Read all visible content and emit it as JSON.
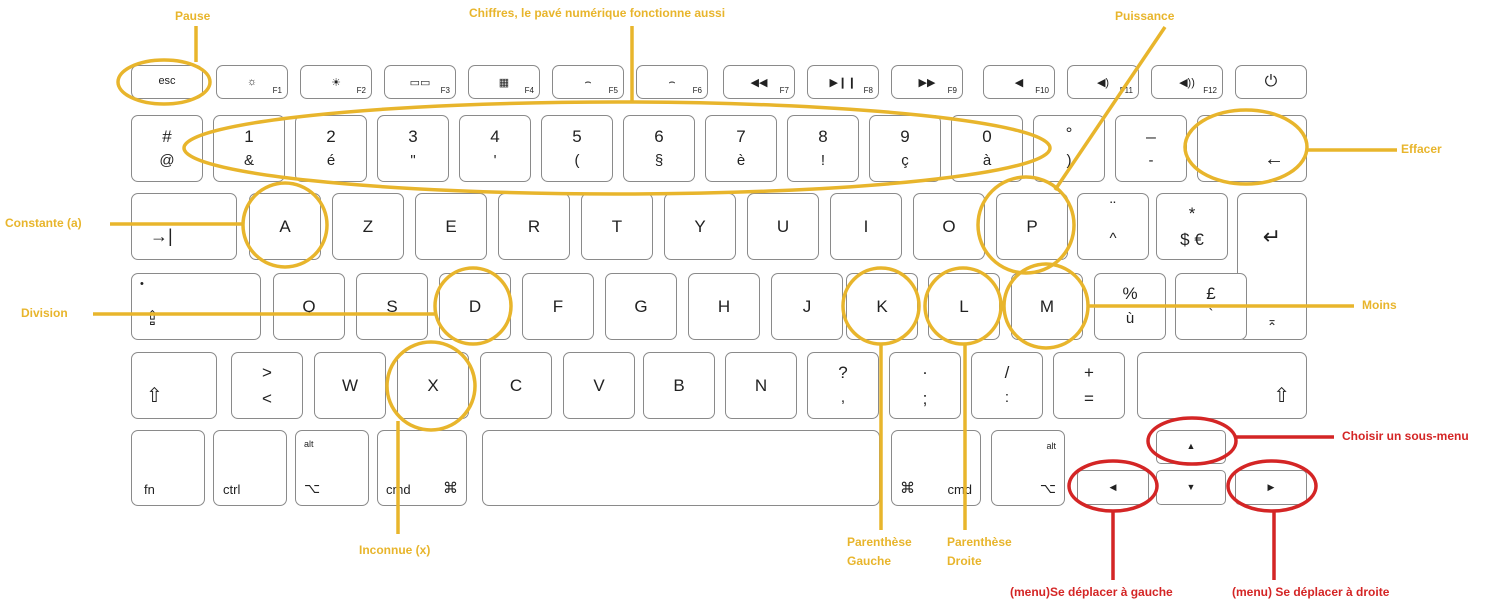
{
  "colors": {
    "annotation_yellow": "#e8b52c",
    "annotation_red": "#d42525",
    "key_border": "#8a8a8a"
  },
  "annotations": {
    "pause": "Pause",
    "chiffres": "Chiffres, le pavé numérique fonctionne aussi",
    "puissance": "Puissance",
    "effacer": "Effacer",
    "constante": "Constante (a)",
    "division": "Division",
    "moins": "Moins",
    "choisir": "Choisir un sous-menu",
    "inconnue": "Inconnue (x)",
    "par_gauche_1": "Parenthèse",
    "par_gauche_2": "Gauche",
    "par_droite_1": "Parenthèse",
    "par_droite_2": "Droite",
    "menu_gauche": "(menu)Se déplacer à gauche",
    "menu_droite": "(menu) Se déplacer à droite"
  },
  "keys": {
    "esc": "esc",
    "f1": {
      "icon": "☼",
      "label": "F1"
    },
    "f2": {
      "icon": "☀",
      "label": "F2"
    },
    "f3": {
      "icon": "▭▭",
      "label": "F3"
    },
    "f4": {
      "icon": "▦",
      "label": "F4"
    },
    "f5": {
      "icon": "⌢",
      "label": "F5"
    },
    "f6": {
      "icon": "⌢",
      "label": "F6"
    },
    "f7": {
      "icon": "◀◀",
      "label": "F7"
    },
    "f8": {
      "icon": "▶❙❙",
      "label": "F8"
    },
    "f9": {
      "icon": "▶▶",
      "label": "F9"
    },
    "f10": {
      "icon": "◀",
      "label": "F10"
    },
    "f11": {
      "icon": "◀)",
      "label": "F11"
    },
    "f12": {
      "icon": "◀))",
      "label": "F12"
    },
    "power": "⏻",
    "num": [
      {
        "top": "#",
        "bottom": "@"
      },
      {
        "top": "1",
        "bottom": "&"
      },
      {
        "top": "2",
        "bottom": "é"
      },
      {
        "top": "3",
        "bottom": "\""
      },
      {
        "top": "4",
        "bottom": "'"
      },
      {
        "top": "5",
        "bottom": "("
      },
      {
        "top": "6",
        "bottom": "§"
      },
      {
        "top": "7",
        "bottom": "è"
      },
      {
        "top": "8",
        "bottom": "!"
      },
      {
        "top": "9",
        "bottom": "ç"
      },
      {
        "top": "0",
        "bottom": "à"
      },
      {
        "top": "°",
        "bottom": ")"
      },
      {
        "top": "_",
        "bottom": "-"
      }
    ],
    "backspace": "←",
    "tab": "→|",
    "row_a": [
      "A",
      "Z",
      "E",
      "R",
      "T",
      "Y",
      "U",
      "I",
      "O",
      "P"
    ],
    "caret": {
      "top": "¨",
      "bottom": "^"
    },
    "dollar": {
      "top": "*",
      "bottom": "$ €"
    },
    "enter": "↵",
    "caps_dot": "•",
    "caps": "⇪",
    "row_q": [
      "Q",
      "S",
      "D",
      "F",
      "G",
      "H",
      "J",
      "K",
      "L",
      "M"
    ],
    "percent": {
      "top": "%",
      "bottom": "ù"
    },
    "pound": {
      "top": "£",
      "bottom": "`"
    },
    "enter_bottom": "⌅",
    "shift_left": "⇧",
    "angle": {
      "top": ">",
      "bottom": "<"
    },
    "row_w": [
      "W",
      "X",
      "C",
      "V",
      "B",
      "N"
    ],
    "question": {
      "top": "?",
      "bottom": ","
    },
    "period": {
      "top": ".",
      "bottom": ";"
    },
    "slash": {
      "top": "/",
      "bottom": ":"
    },
    "plus": {
      "top": "+",
      "bottom": "="
    },
    "shift_right": "⇧",
    "fn": "fn",
    "ctrl": "ctrl",
    "alt": "alt",
    "opt": "⌥",
    "cmd": "cmd",
    "cmd_sym": "⌘",
    "arrow_up": "▲",
    "arrow_down": "▼",
    "arrow_left": "◀",
    "arrow_right": "▶"
  }
}
